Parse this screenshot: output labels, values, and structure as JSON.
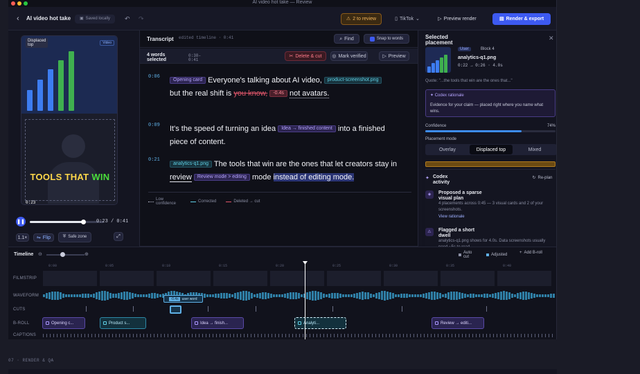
{
  "window": {
    "title": "AI video hot take — Review"
  },
  "topbar": {
    "back": "‹",
    "project_title": "AI video hot take",
    "saved_label": "Saved locally",
    "review_badge": "2 to review",
    "platform": "TikTok",
    "preview_label": "Preview render",
    "render_label": "Render & export"
  },
  "preview": {
    "displaced_label": "Displaced",
    "top_label": "top",
    "video_badge": "Video",
    "caption_words": [
      "TOOLS",
      "THAT",
      "WIN"
    ],
    "timestamp": "0:23",
    "current_time": "0:23 / 0:41",
    "progress": 0.72,
    "speed": "1.1×",
    "flip_label": "Flip",
    "safe_zone_label": "Safe zone",
    "bars": [
      0.35,
      0.52,
      0.7,
      0.85,
      1.0
    ]
  },
  "transcript": {
    "title": "Transcript",
    "subtitle": "edited timeline · 0:41",
    "find_label": "Find",
    "snap_label": "Snap to words",
    "selection_count": "4 words selected",
    "selection_range": "0:38–0:41",
    "delete_label": "Delete & cut",
    "mark_label": "Mark verified",
    "preview_label": "Preview",
    "paragraphs": [
      {
        "time": "0:06",
        "chip1": "Opening card",
        "text1": "Everyone's talking about AI video,",
        "chip2": "product-screenshot.png",
        "text2": "but the real shift is",
        "struck": "you know,",
        "cut_badge": "-0.4s",
        "text3": "not avatars."
      },
      {
        "time": "0:09",
        "text1": "It's the speed of turning an idea",
        "chip1": "Idea → finished content",
        "text2": "into a finished",
        "text3": "piece of content."
      },
      {
        "time": "0:21",
        "chip1": "analytics-q1.png",
        "text1": "The tools that win are the ones that let creators stay in",
        "word_review": "review",
        "chip2": "Review mode > editing",
        "text2": "mode",
        "highlight": "instead of editing mode."
      }
    ],
    "legend": {
      "low": "Low confidence",
      "corrected": "Corrected",
      "deleted": "Deleted → cut"
    }
  },
  "panel": {
    "title": "Selected placement",
    "user_badge": "User",
    "kind": "Block 4",
    "file": "analytics-q1.png",
    "range": "0:22 → 0:26 · 4.0s",
    "quote": "Quote: \"...the tools that win are the ones that...\"",
    "rationale_title": "Codex rationale",
    "rationale": "Evidence for your claim — placed right where you name what wins.",
    "confidence_label": "Confidence",
    "confidence": 74,
    "confidence_text": "74%",
    "placement_mode_label": "Placement mode",
    "modes": [
      "Overlay",
      "Displaced top",
      "Mixed"
    ],
    "active_mode": "Displaced top",
    "activity_title": "Codex activity",
    "replan_label": "Re-plan",
    "activity": [
      {
        "title": "Proposed a sparse visual plan",
        "body": "4 placements across 0:45 — 3 visual cards and 2 of your screenshots.",
        "link": "View rationale"
      },
      {
        "title": "Flagged a short dwell",
        "body": "analytics-q1.png shows for 4.0s. Data screenshots usually need ~5s to read."
      }
    ]
  },
  "timeline": {
    "label": "Timeline",
    "auto_cut": "Auto cut",
    "adjusted": "Adjusted",
    "add_broll": "Add B-roll",
    "tracks": [
      "FILMSTRIP",
      "WAVEFORM",
      "CUTS",
      "B-ROLL",
      "CAPTIONS"
    ],
    "ticks": [
      "0:00",
      "0:05",
      "0:10",
      "0:15",
      "0:20",
      "0:25",
      "0:30",
      "0:35",
      "0:40"
    ],
    "selection_labels": [
      "-0.4s",
      "user word"
    ],
    "clips": [
      "Opening c...",
      "Product s...",
      "Idea → finish...",
      "Analyti...",
      "Review → editi..."
    ]
  },
  "footer": {
    "section_label": "07 · RENDER & QA"
  }
}
